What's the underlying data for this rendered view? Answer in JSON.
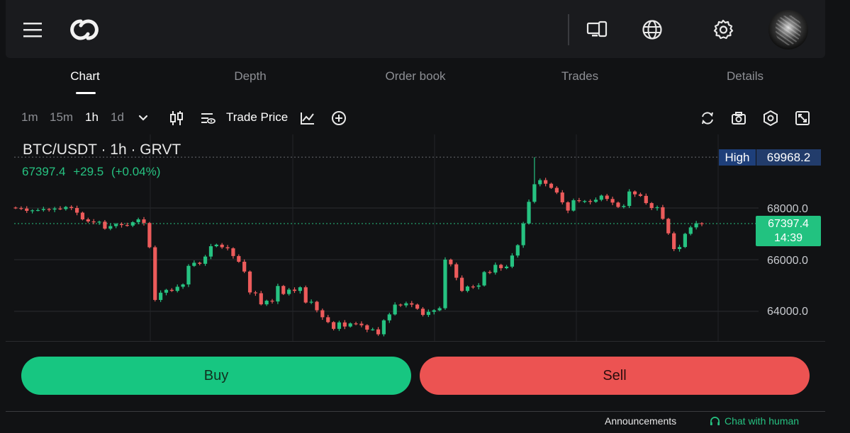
{
  "header": {
    "menu_icon": "hamburger-menu-icon",
    "logo_icon": "app-logo-icon",
    "device_icon": "devices-icon",
    "language_icon": "globe-icon",
    "settings_icon": "gear-icon",
    "avatar_icon": "user-avatar"
  },
  "tabs": [
    {
      "label": "Chart",
      "active": true
    },
    {
      "label": "Depth",
      "active": false
    },
    {
      "label": "Order book",
      "active": false
    },
    {
      "label": "Trades",
      "active": false
    },
    {
      "label": "Details",
      "active": false
    }
  ],
  "toolbar": {
    "timeframes": [
      "1m",
      "15m",
      "1h",
      "1d"
    ],
    "active_timeframe": "1h",
    "trade_price_label": "Trade Price",
    "icons": [
      "chevron-down-icon",
      "candlestick-type-icon",
      "indicator-settings-icon",
      "indicators-icon",
      "add-icon",
      "refresh-icon",
      "camera-icon",
      "chart-settings-icon",
      "fullscreen-icon"
    ]
  },
  "chart": {
    "pair_title": "BTC/USDT · 1h · GRVT",
    "last_price": "67397.4",
    "change_abs": "+29.5",
    "change_pct": "(+0.04%)",
    "high_label": "High",
    "high_value": "69968.2",
    "current_price_tag": "67397.4",
    "countdown": "14:39",
    "axis_labels": [
      "68000.0",
      "66000.0",
      "64000.0"
    ],
    "up_color": "#26c281",
    "down_color": "#ec5b5b"
  },
  "chart_data": {
    "type": "candlestick",
    "symbol": "BTC/USDT",
    "interval": "1h",
    "y_ticks": [
      64000,
      66000,
      68000
    ],
    "high_marker": 69968.2,
    "last_price": 67397.4,
    "closes": [
      67998,
      67980,
      67890,
      67910,
      67920,
      67960,
      67940,
      67980,
      67960,
      68040,
      68000,
      67820,
      67560,
      67480,
      67450,
      67470,
      67200,
      67300,
      67380,
      67340,
      67320,
      67450,
      67560,
      67420,
      66480,
      64440,
      64720,
      64830,
      64790,
      64950,
      65040,
      65760,
      65880,
      65840,
      66120,
      66520,
      66580,
      66480,
      66440,
      66140,
      65920,
      65540,
      64730,
      64700,
      64270,
      64410,
      64380,
      64980,
      64670,
      64840,
      64790,
      64930,
      64340,
      64370,
      64040,
      63770,
      63580,
      63320,
      63570,
      63410,
      63530,
      63520,
      63460,
      63290,
      63300,
      63110,
      63650,
      63880,
      64260,
      64230,
      64310,
      64260,
      64100,
      63860,
      63980,
      64040,
      64120,
      66000,
      65820,
      65300,
      64790,
      64960,
      64950,
      65000,
      65520,
      65500,
      65800,
      65670,
      65730,
      66160,
      66560,
      67400,
      68240,
      68920,
      69080,
      68940,
      68780,
      68600,
      68220,
      67900,
      68300,
      68270,
      68270,
      68240,
      68320,
      68480,
      68350,
      68210,
      68040,
      68080,
      68640,
      68530,
      68470,
      68190,
      68000,
      68030,
      67580,
      67020,
      66410,
      66490,
      67000,
      67250,
      67410,
      67397
    ]
  }
}
